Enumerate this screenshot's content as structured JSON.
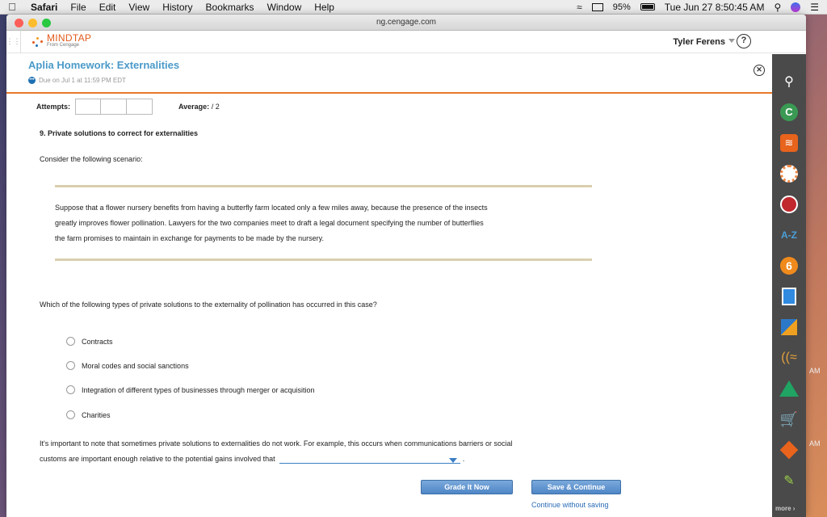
{
  "menubar": {
    "apple": "",
    "items": [
      "Safari",
      "File",
      "Edit",
      "View",
      "History",
      "Bookmarks",
      "Window",
      "Help"
    ],
    "battery": "95%",
    "clock": "Tue Jun 27  8:50:45 AM"
  },
  "browser": {
    "url": "ng.cengage.com"
  },
  "header": {
    "logo_name": "MINDTAP",
    "logo_sub": "From Cengage",
    "user_name": "Tyler Ferens",
    "help_label": "?"
  },
  "activity": {
    "title": "Aplia Homework: Externalities",
    "due": "Due on Jul 1 at 11:59 PM EDT",
    "attempts_label": "Attempts:",
    "average_label": "Average:",
    "average_value": "/ 2"
  },
  "question": {
    "title": "9. Private solutions to correct for externalities",
    "intro": "Consider the following scenario:",
    "scenario_lines": [
      "Suppose that a flower nursery benefits from having a butterfly farm located only a few miles away, because the presence of the insects",
      "greatly improves flower pollination. Lawyers for the two companies meet to draft a legal document specifying the number of butterflies",
      "the farm promises to maintain in exchange for payments to be made by the nursery."
    ],
    "prompt": "Which of the following types of private solutions to the externality of pollination has occurred in this case?",
    "options": [
      "Contracts",
      "Moral codes and social sanctions",
      "Integration of different types of businesses through merger or acquisition",
      "Charities"
    ],
    "note_line1": "It's important to note that sometimes private solutions to externalities do not work. For example, this occurs when communications barriers or social",
    "note_line2": "customs are important enough relative to the potential gains involved that",
    "note_end": "."
  },
  "actions": {
    "grade": "Grade It Now",
    "save": "Save & Continue",
    "continue": "Continue without saving"
  },
  "dock": {
    "az_label": "A-Z",
    "more": "more"
  },
  "desktop": {
    "am1": "AM",
    "am2": "AM"
  }
}
